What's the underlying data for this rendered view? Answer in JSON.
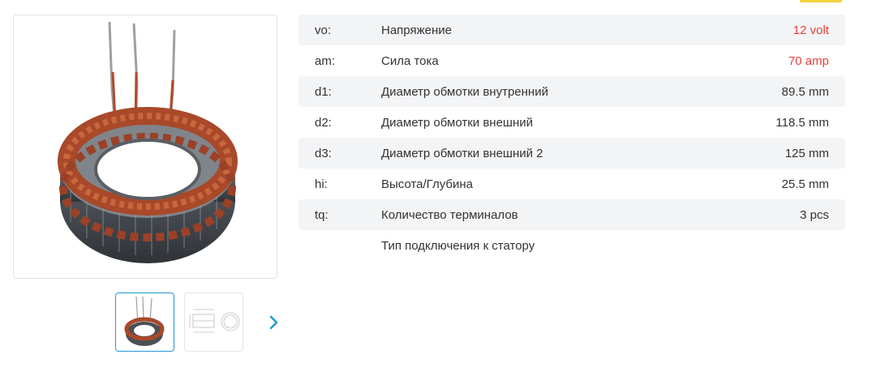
{
  "specs": {
    "rows": [
      {
        "code": "vo:",
        "label": "Напряжение",
        "value": "12 volt",
        "highlight": true
      },
      {
        "code": "am:",
        "label": "Сила тока",
        "value": "70 amp",
        "highlight": true
      },
      {
        "code": "d1:",
        "label": "Диаметр обмотки внутренний",
        "value": "89.5 mm"
      },
      {
        "code": "d2:",
        "label": "Диаметр обмотки внешний",
        "value": "118.5 mm"
      },
      {
        "code": "d3:",
        "label": "Диаметр обмотки внешний 2",
        "value": "125 mm"
      },
      {
        "code": "hi:",
        "label": "Высота/Глубина",
        "value": "25.5 mm"
      },
      {
        "code": "tq:",
        "label": "Количество терминалов",
        "value": "3 pcs"
      },
      {
        "code": "",
        "label": "Тип подключения к статору",
        "value": ""
      }
    ]
  },
  "gallery": {
    "next_icon": "chevron-right-icon",
    "accent_color": "#1d9ad6"
  },
  "colors": {
    "value_highlight": "#e8403a",
    "row_shade": "#f3f4f6",
    "thumb_active_border": "#1d9ad6"
  }
}
